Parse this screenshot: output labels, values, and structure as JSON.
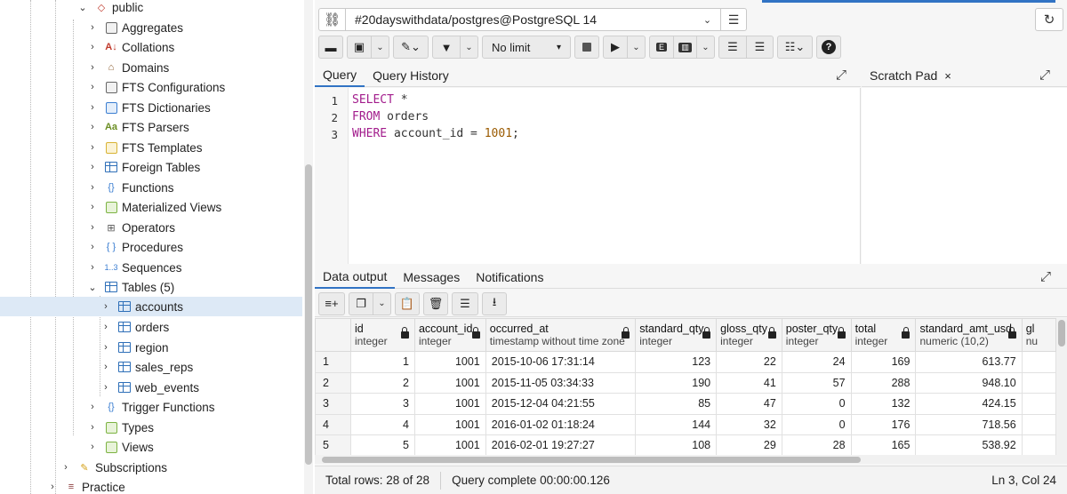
{
  "tree": {
    "items": [
      {
        "label": "public",
        "icon": "schema-icon"
      },
      {
        "label": "Aggregates",
        "icon": "aggregate-icon"
      },
      {
        "label": "Collations",
        "icon": "collation-icon"
      },
      {
        "label": "Domains",
        "icon": "domain-icon"
      },
      {
        "label": "FTS Configurations",
        "icon": "fts-config-icon"
      },
      {
        "label": "FTS Dictionaries",
        "icon": "fts-dictionary-icon"
      },
      {
        "label": "FTS Parsers",
        "icon": "fts-parser-icon"
      },
      {
        "label": "FTS Templates",
        "icon": "fts-template-icon"
      },
      {
        "label": "Foreign Tables",
        "icon": "foreign-table-icon"
      },
      {
        "label": "Functions",
        "icon": "function-icon"
      },
      {
        "label": "Materialized Views",
        "icon": "materialized-view-icon"
      },
      {
        "label": "Operators",
        "icon": "operator-icon"
      },
      {
        "label": "Procedures",
        "icon": "procedure-icon"
      },
      {
        "label": "Sequences",
        "icon": "sequence-icon"
      },
      {
        "label": "Tables (5)",
        "icon": "tables-icon"
      },
      {
        "label": "accounts",
        "icon": "table-icon"
      },
      {
        "label": "orders",
        "icon": "table-icon"
      },
      {
        "label": "region",
        "icon": "table-icon"
      },
      {
        "label": "sales_reps",
        "icon": "table-icon"
      },
      {
        "label": "web_events",
        "icon": "table-icon"
      },
      {
        "label": "Trigger Functions",
        "icon": "trigger-function-icon"
      },
      {
        "label": "Types",
        "icon": "type-icon"
      },
      {
        "label": "Views",
        "icon": "view-icon"
      },
      {
        "label": "Subscriptions",
        "icon": "subscription-icon"
      },
      {
        "label": "Practice",
        "icon": "database-icon"
      }
    ]
  },
  "connection": {
    "label": "#20dayswithdata/postgres@PostgreSQL 14"
  },
  "toolbar": {
    "limit_label": "No limit"
  },
  "query": {
    "tabs": [
      "Query",
      "Query History"
    ],
    "lines": [
      {
        "n": "1",
        "kw": "SELECT",
        "rest": " *"
      },
      {
        "n": "2",
        "kw": "FROM",
        "rest": " orders"
      },
      {
        "n": "3",
        "kw": "WHERE",
        "rest": " account_id = ",
        "num": "1001",
        "tail": ";"
      }
    ]
  },
  "scratch": {
    "title": "Scratch Pad",
    "close": "×"
  },
  "results": {
    "tabs": [
      "Data output",
      "Messages",
      "Notifications"
    ],
    "columns": [
      {
        "name": "id",
        "type": "integer"
      },
      {
        "name": "account_id",
        "type": "integer"
      },
      {
        "name": "occurred_at",
        "type": "timestamp without time zone"
      },
      {
        "name": "standard_qty",
        "type": "integer"
      },
      {
        "name": "gloss_qty",
        "type": "integer"
      },
      {
        "name": "poster_qty",
        "type": "integer"
      },
      {
        "name": "total",
        "type": "integer"
      },
      {
        "name": "standard_amt_usd",
        "type": "numeric (10,2)"
      },
      {
        "name": "gl",
        "type": "nu"
      }
    ],
    "rows": [
      [
        "1",
        "1",
        "1001",
        "2015-10-06 17:31:14",
        "123",
        "22",
        "24",
        "169",
        "613.77"
      ],
      [
        "2",
        "2",
        "1001",
        "2015-11-05 03:34:33",
        "190",
        "41",
        "57",
        "288",
        "948.10"
      ],
      [
        "3",
        "3",
        "1001",
        "2015-12-04 04:21:55",
        "85",
        "47",
        "0",
        "132",
        "424.15"
      ],
      [
        "4",
        "4",
        "1001",
        "2016-01-02 01:18:24",
        "144",
        "32",
        "0",
        "176",
        "718.56"
      ],
      [
        "5",
        "5",
        "1001",
        "2016-02-01 19:27:27",
        "108",
        "29",
        "28",
        "165",
        "538.92"
      ]
    ]
  },
  "status": {
    "total_rows": "Total rows: 28 of 28",
    "query_complete": "Query complete 00:00:00.126",
    "cursor": "Ln 3, Col 24"
  }
}
